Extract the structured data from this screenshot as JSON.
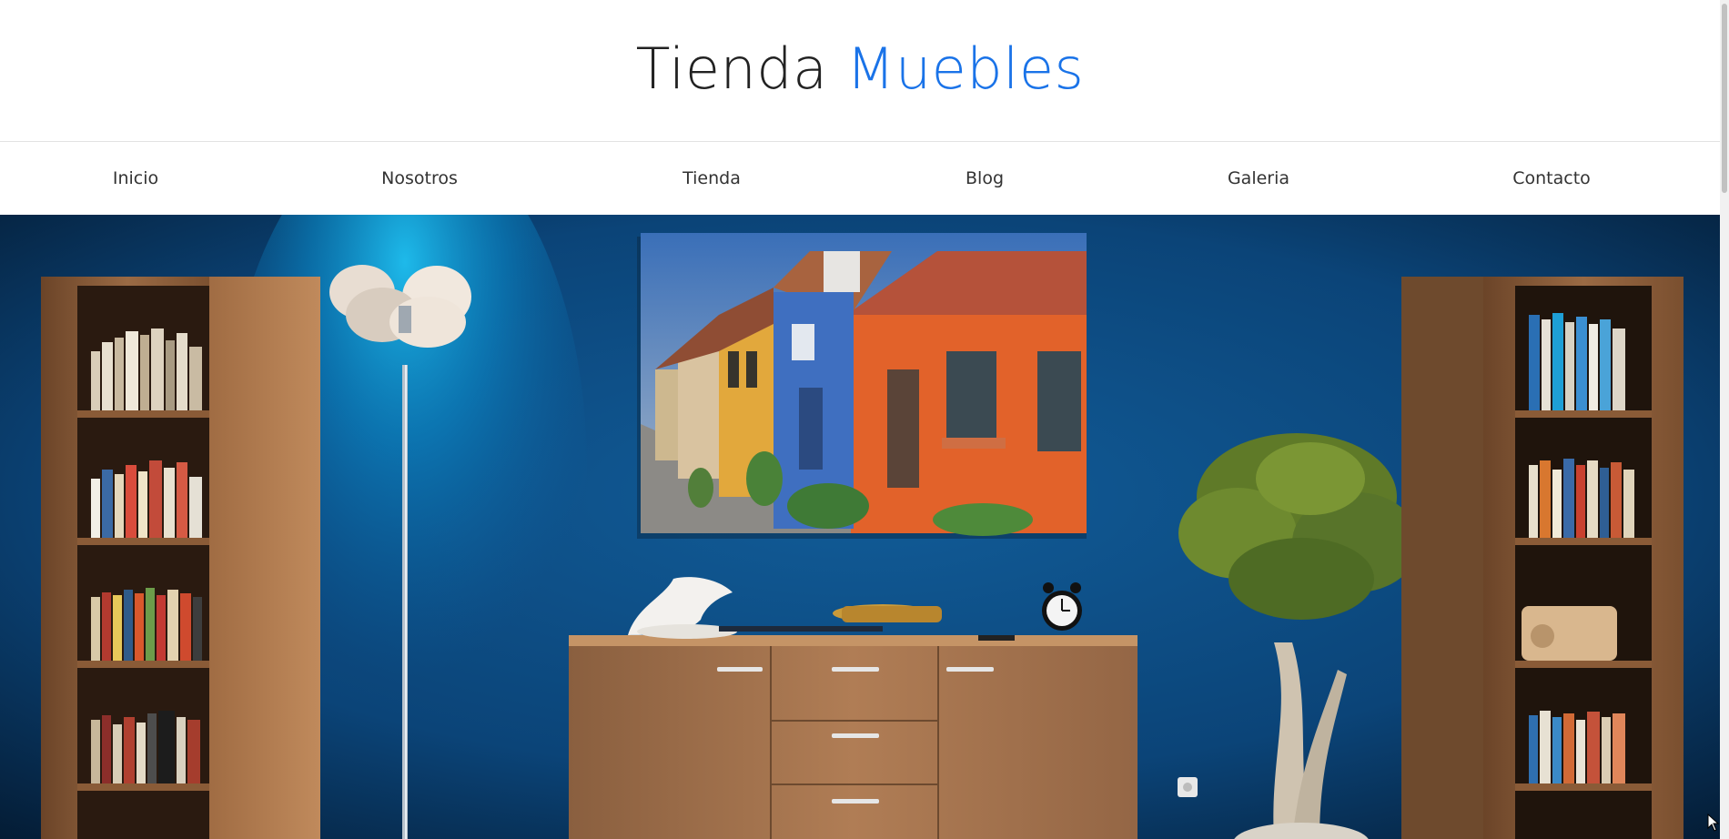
{
  "site": {
    "title_part1": "Tienda",
    "title_part2": "Muebles",
    "accent_color": "#1a73e8"
  },
  "nav": {
    "items": [
      {
        "label": "Inicio"
      },
      {
        "label": "Nosotros"
      },
      {
        "label": "Tienda"
      },
      {
        "label": "Blog"
      },
      {
        "label": "Galeria"
      },
      {
        "label": "Contacto"
      }
    ]
  },
  "hero": {
    "image": "living-room-photo",
    "wall_color": "#0d4f86",
    "furniture": [
      "bookshelf-left",
      "floor-lamp",
      "wall-painting",
      "sideboard",
      "bonsai-tree",
      "bookshelf-right"
    ]
  },
  "scrollbar": {
    "icon": "scrollbar-thumb"
  },
  "cursor": {
    "icon": "mouse-pointer-icon"
  }
}
